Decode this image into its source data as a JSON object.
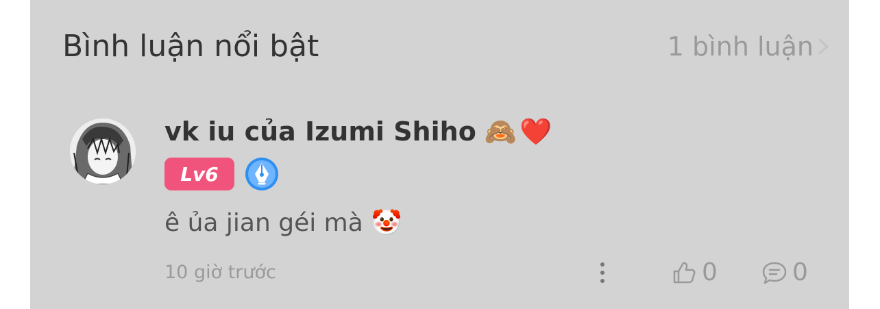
{
  "section": {
    "title": "Bình luận nổi bật",
    "count_label": "1 bình luận",
    "chevron_icon": "chevron-right-icon"
  },
  "comment": {
    "avatar_icon": "user-avatar",
    "username": "vk iu của Izumi Shiho",
    "username_emojis": [
      "🙈",
      "❤️"
    ],
    "level_badge": "Lv6",
    "creator_badge_icon": "pen-nib-badge-icon",
    "text": "ê ủa jian géi mà",
    "text_emoji": "🤡",
    "timestamp": "10 giờ trước",
    "likes": "0",
    "replies": "0"
  },
  "colors": {
    "panel_bg": "#d3d3d3",
    "level_badge_bg": "#f0547c",
    "creator_badge_blue": "#2f8ff0",
    "muted_text": "#9a9a9a"
  }
}
